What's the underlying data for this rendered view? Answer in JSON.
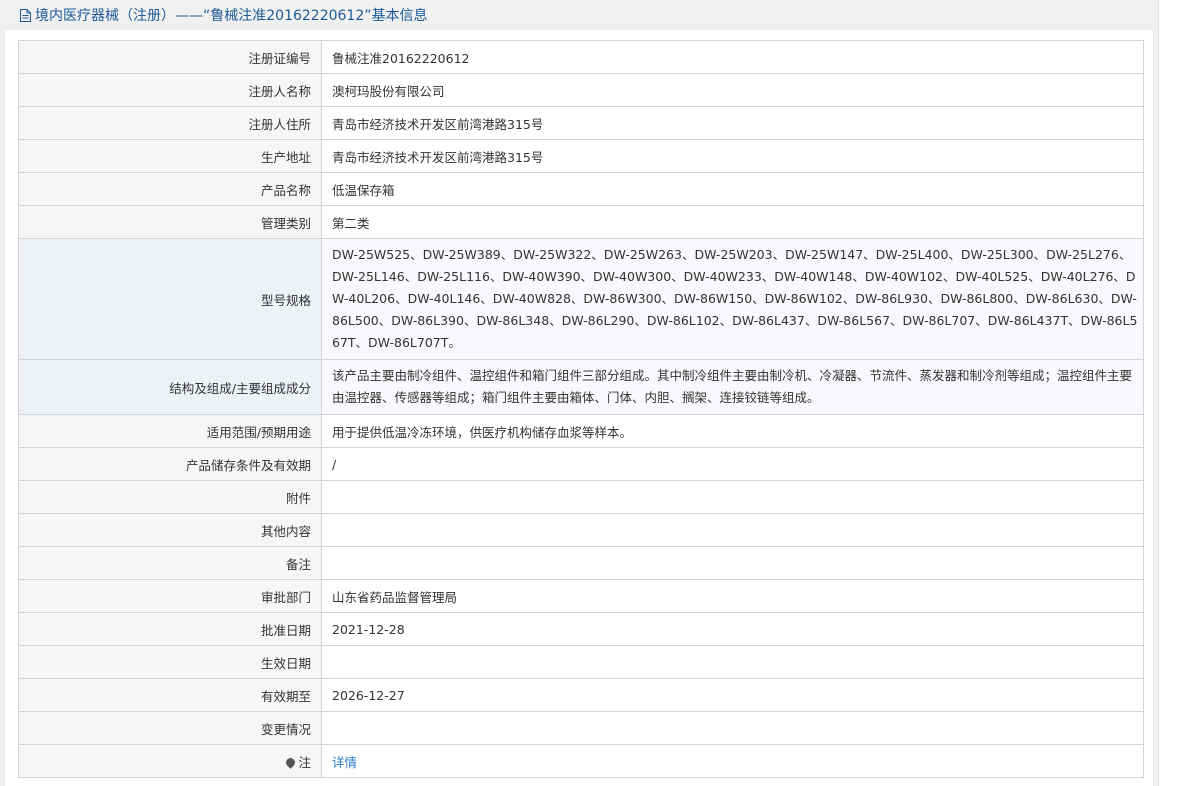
{
  "title": "境内医疗器械（注册）——“鲁械注准20162220612”基本信息",
  "rows": [
    {
      "label": "注册证编号",
      "value": "鲁械注准20162220612"
    },
    {
      "label": "注册人名称",
      "value": "澳柯玛股份有限公司"
    },
    {
      "label": "注册人住所",
      "value": "青岛市经济技术开发区前湾港路315号"
    },
    {
      "label": "生产地址",
      "value": "青岛市经济技术开发区前湾港路315号"
    },
    {
      "label": "产品名称",
      "value": "低温保存箱"
    },
    {
      "label": "管理类别",
      "value": "第二类"
    },
    {
      "label": "型号规格",
      "value": "DW-25W525、DW-25W389、DW-25W322、DW-25W263、DW-25W203、DW-25W147、DW-25L400、DW-25L300、DW-25L276、DW-25L146、DW-25L116、DW-40W390、DW-40W300、DW-40W233、DW-40W148、DW-40W102、DW-40L525、DW-40L276、DW-40L206、DW-40L146、DW-40W828、DW-86W300、DW-86W150、DW-86W102、DW-86L930、DW-86L800、DW-86L630、DW-86L500、DW-86L390、DW-86L348、DW-86L290、DW-86L102、DW-86L437、DW-86L567、DW-86L707、DW-86L437T、DW-86L567T、DW-86L707T。"
    },
    {
      "label": "结构及组成/主要组成成分",
      "value": "该产品主要由制冷组件、温控组件和箱门组件三部分组成。其中制冷组件主要由制冷机、冷凝器、节流件、蒸发器和制冷剂等组成；温控组件主要由温控器、传感器等组成；箱门组件主要由箱体、门体、内胆、搁架、连接铰链等组成。"
    },
    {
      "label": "适用范围/预期用途",
      "value": "用于提供低温冷冻环境，供医疗机构储存血浆等样本。"
    },
    {
      "label": "产品储存条件及有效期",
      "value": "/"
    },
    {
      "label": "附件",
      "value": ""
    },
    {
      "label": "其他内容",
      "value": ""
    },
    {
      "label": "备注",
      "value": ""
    },
    {
      "label": "审批部门",
      "value": "山东省药品监督管理局"
    },
    {
      "label": "批准日期",
      "value": "2021-12-28"
    },
    {
      "label": "生效日期",
      "value": ""
    },
    {
      "label": "有效期至",
      "value": "2026-12-27"
    },
    {
      "label": "变更情况",
      "value": ""
    },
    {
      "label": "注",
      "value": "详情"
    }
  ],
  "icons": {
    "title": "document-icon",
    "note": "pin-icon"
  },
  "colors": {
    "title": "#1d5a97",
    "link": "#2f7bc9",
    "border": "#d4d4d4",
    "label_bg": "#f6f6f6"
  }
}
